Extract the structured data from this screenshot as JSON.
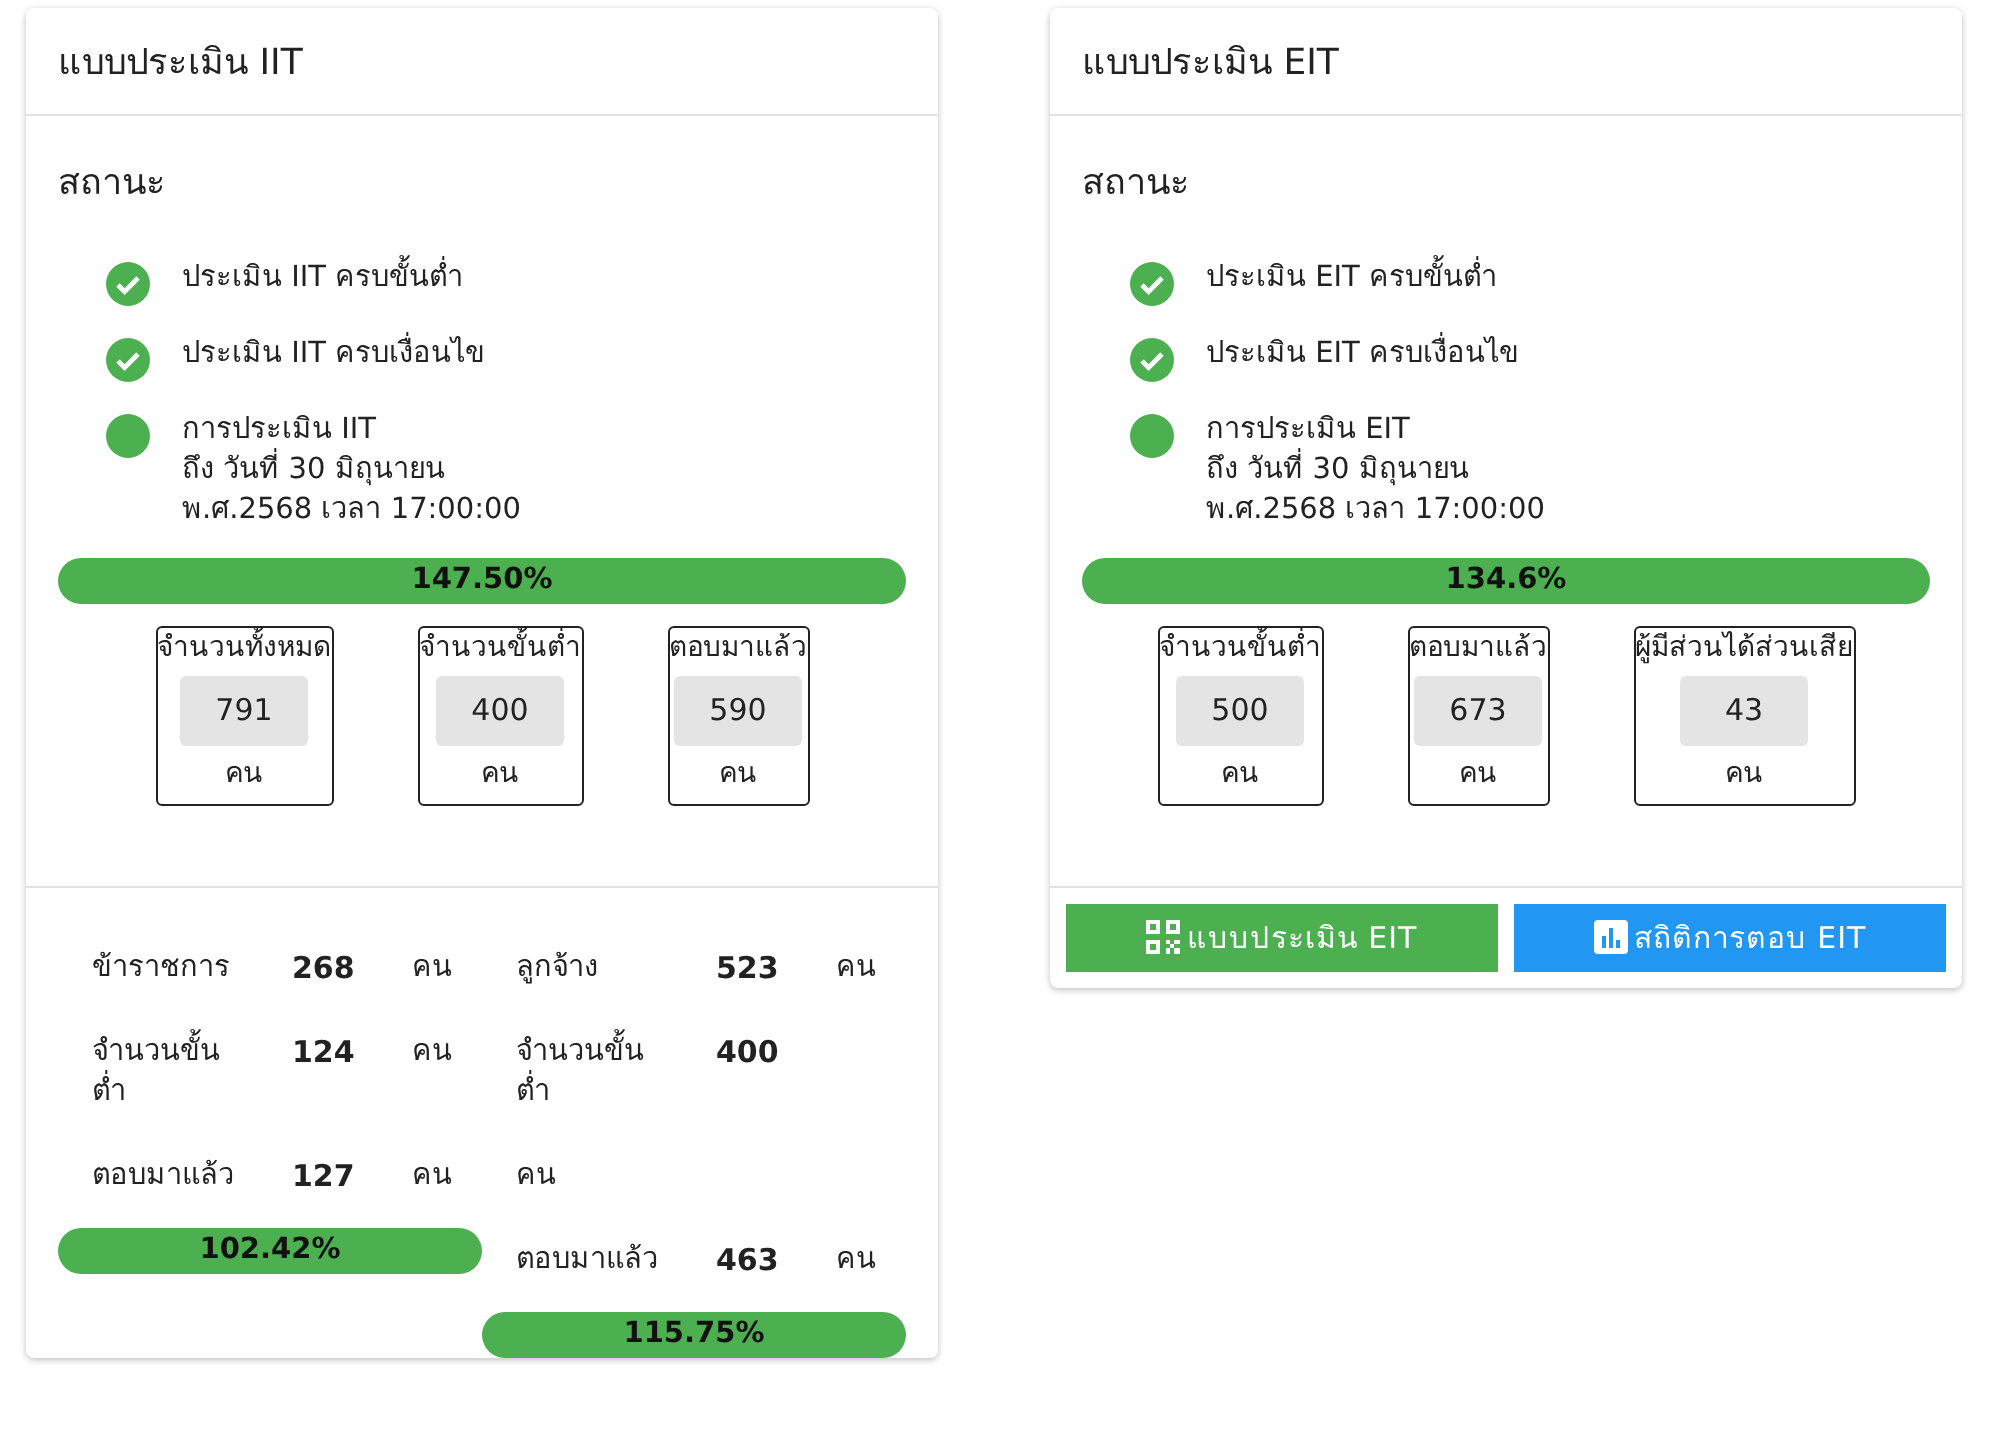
{
  "cards": [
    {
      "title": "แบบประเมิน IIT",
      "status_heading": "สถานะ",
      "status_items": [
        {
          "kind": "check",
          "lines": [
            "ประเมิน IIT ครบขั้นต่ำ"
          ]
        },
        {
          "kind": "check",
          "lines": [
            "ประเมิน IIT ครบเงื่อนไข"
          ]
        },
        {
          "kind": "dot",
          "lines": [
            "การประเมิน IIT",
            "ถึง วันที่ 30 มิถุนายน",
            "พ.ศ.2568 เวลา 17:00:00"
          ]
        }
      ],
      "progress": {
        "level": 1,
        "label": "147.50%"
      },
      "stats": [
        {
          "label": "จำนวนทั้งหมด",
          "value": "791",
          "unit": "คน"
        },
        {
          "label": "จำนวนขั้นต่ำ",
          "value": "400",
          "unit": "คน"
        },
        {
          "label": "ตอบมาแล้ว",
          "value": "590",
          "unit": "คน"
        }
      ],
      "breakdown": [
        {
          "rows": [
            {
              "label": "ข้าราชการ",
              "value": "268",
              "unit": "คน"
            },
            {
              "label": "จำนวนขั้นต่ำ",
              "value": "124",
              "unit": "คน"
            },
            {
              "label": "ตอบมาแล้ว",
              "value": "127",
              "unit": "คน"
            }
          ],
          "progress": {
            "level": 1,
            "label": "102.42%"
          }
        },
        {
          "rows": [
            {
              "label": "ลูกจ้าง",
              "value": "523",
              "unit": "คน"
            },
            {
              "label": "จำนวนขั้นต่ำ",
              "value": "400"
            },
            {
              "label": "คน"
            },
            {
              "label": "ตอบมาแล้ว",
              "value": "463",
              "unit": "คน"
            }
          ],
          "progress": {
            "level": 1,
            "label": "115.75%"
          }
        }
      ]
    },
    {
      "title": "แบบประเมิน EIT",
      "status_heading": "สถานะ",
      "status_items": [
        {
          "kind": "check",
          "lines": [
            "ประเมิน EIT ครบขั้นต่ำ"
          ]
        },
        {
          "kind": "check",
          "lines": [
            "ประเมิน EIT ครบเงื่อนไข"
          ]
        },
        {
          "kind": "dot",
          "lines": [
            "การประเมิน EIT",
            "ถึง วันที่ 30 มิถุนายน",
            "พ.ศ.2568 เวลา 17:00:00"
          ]
        }
      ],
      "progress": {
        "level": 1,
        "label": "134.6%"
      },
      "stats": [
        {
          "label": "จำนวนขั้นต่ำ",
          "value": "500",
          "unit": "คน"
        },
        {
          "label": "ตอบมาแล้ว",
          "value": "673",
          "unit": "คน"
        },
        {
          "label": "ผู้มีส่วนได้ส่วนเสีย",
          "value": "43",
          "unit": "คน"
        }
      ],
      "buttons": [
        {
          "kind": "qr",
          "label": "แบบประเมิน EIT"
        },
        {
          "kind": "chart",
          "label": "สถิติการตอบ EIT"
        }
      ]
    }
  ]
}
